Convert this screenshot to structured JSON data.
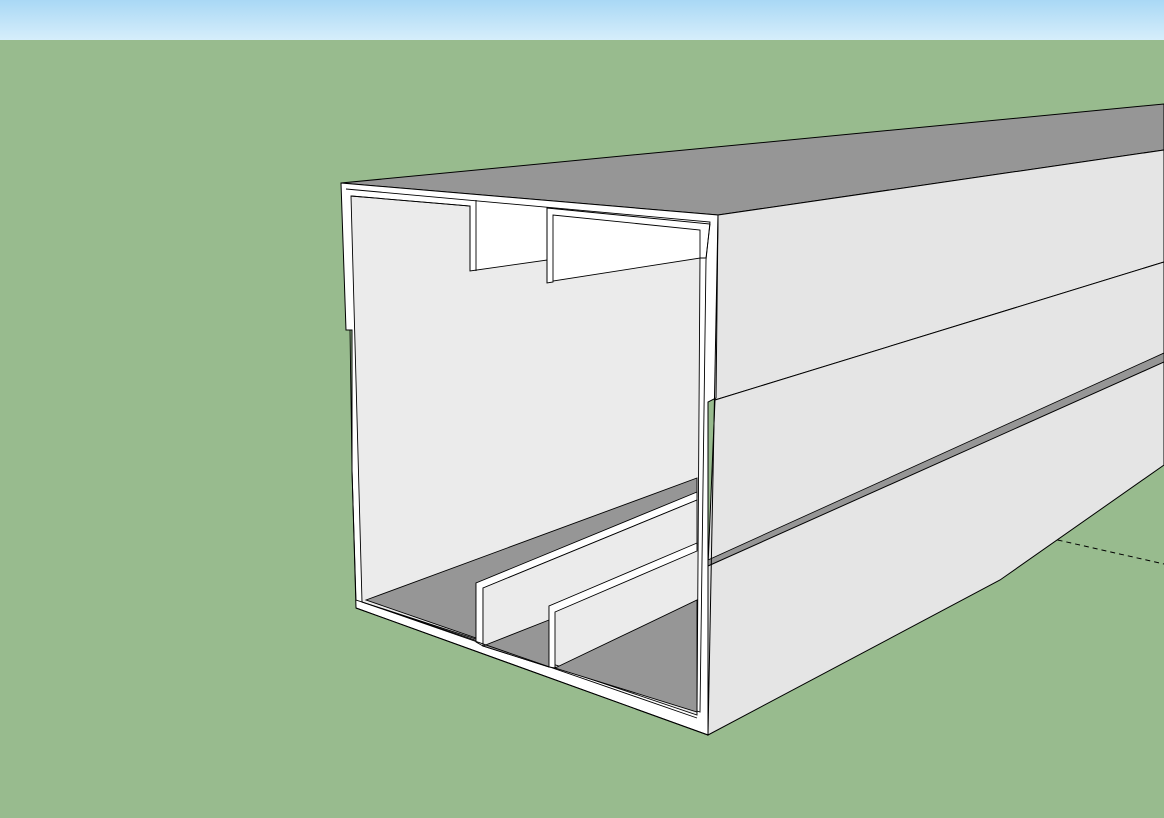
{
  "scene": {
    "sky_gradient_top": "#a9d8f5",
    "sky_gradient_bottom": "#d6eefb",
    "ground_color": "#98bb8e",
    "edge_color": "#000000",
    "face_light_color": "#e5e5e5",
    "face_dark_color": "#969696",
    "inner_wall_color": "#ebebeb",
    "profile_color": "#ffffff",
    "axis_line_color": "#000000"
  }
}
